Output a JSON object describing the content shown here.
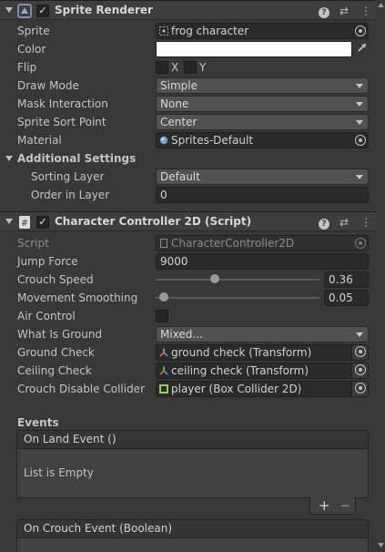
{
  "sprite_renderer": {
    "title": "Sprite Renderer",
    "toggle_check": "✓",
    "menu_glyph": "⋮",
    "help_glyph": "?",
    "settings_glyph": "⇄",
    "fields": {
      "sprite_label": "Sprite",
      "sprite_value": "frog character",
      "color_label": "Color",
      "color_value": "#FFFFFF",
      "flip_label": "Flip",
      "flip_x": "X",
      "flip_y": "Y",
      "draw_mode_label": "Draw Mode",
      "draw_mode_value": "Simple",
      "mask_label": "Mask Interaction",
      "mask_value": "None",
      "sort_point_label": "Sprite Sort Point",
      "sort_point_value": "Center",
      "material_label": "Material",
      "material_value": "Sprites-Default"
    },
    "additional": {
      "header": "Additional Settings",
      "sorting_layer_label": "Sorting Layer",
      "sorting_layer_value": "Default",
      "order_label": "Order in Layer",
      "order_value": "0"
    }
  },
  "controller": {
    "title": "Character Controller 2D (Script)",
    "toggle_check": "✓",
    "menu_glyph": "⋮",
    "help_glyph": "?",
    "settings_glyph": "⇄",
    "script_label": "Script",
    "script_value": "CharacterController2D",
    "jump_label": "Jump Force",
    "jump_value": "9000",
    "crouch_speed_label": "Crouch Speed",
    "crouch_speed_value": "0.36",
    "smoothing_label": "Movement Smoothing",
    "smoothing_value": "0.05",
    "air_label": "Air Control",
    "ground_label": "What Is Ground",
    "ground_value": "Mixed...",
    "ground_check_label": "Ground Check",
    "ground_check_value": "ground check (Transform)",
    "ceiling_label": "Ceiling Check",
    "ceiling_value": "ceiling check (Transform)",
    "crouch_collider_label": "Crouch Disable Collider",
    "crouch_collider_value": "player (Box Collider 2D)"
  },
  "events": {
    "header": "Events",
    "land_event": "On Land Event ()",
    "land_empty": "List is Empty",
    "plus": "+",
    "minus": "−",
    "crouch_event": "On Crouch Event (Boolean)"
  },
  "colors": {
    "panel_bg": "#383838",
    "header_bg": "#3E3E3E",
    "field_bg": "#2A2A2A",
    "dropdown_bg": "#515151"
  },
  "slider_levels": {
    "crouch_speed_fraction": 0.36,
    "smoothing_fraction": 0.05
  }
}
